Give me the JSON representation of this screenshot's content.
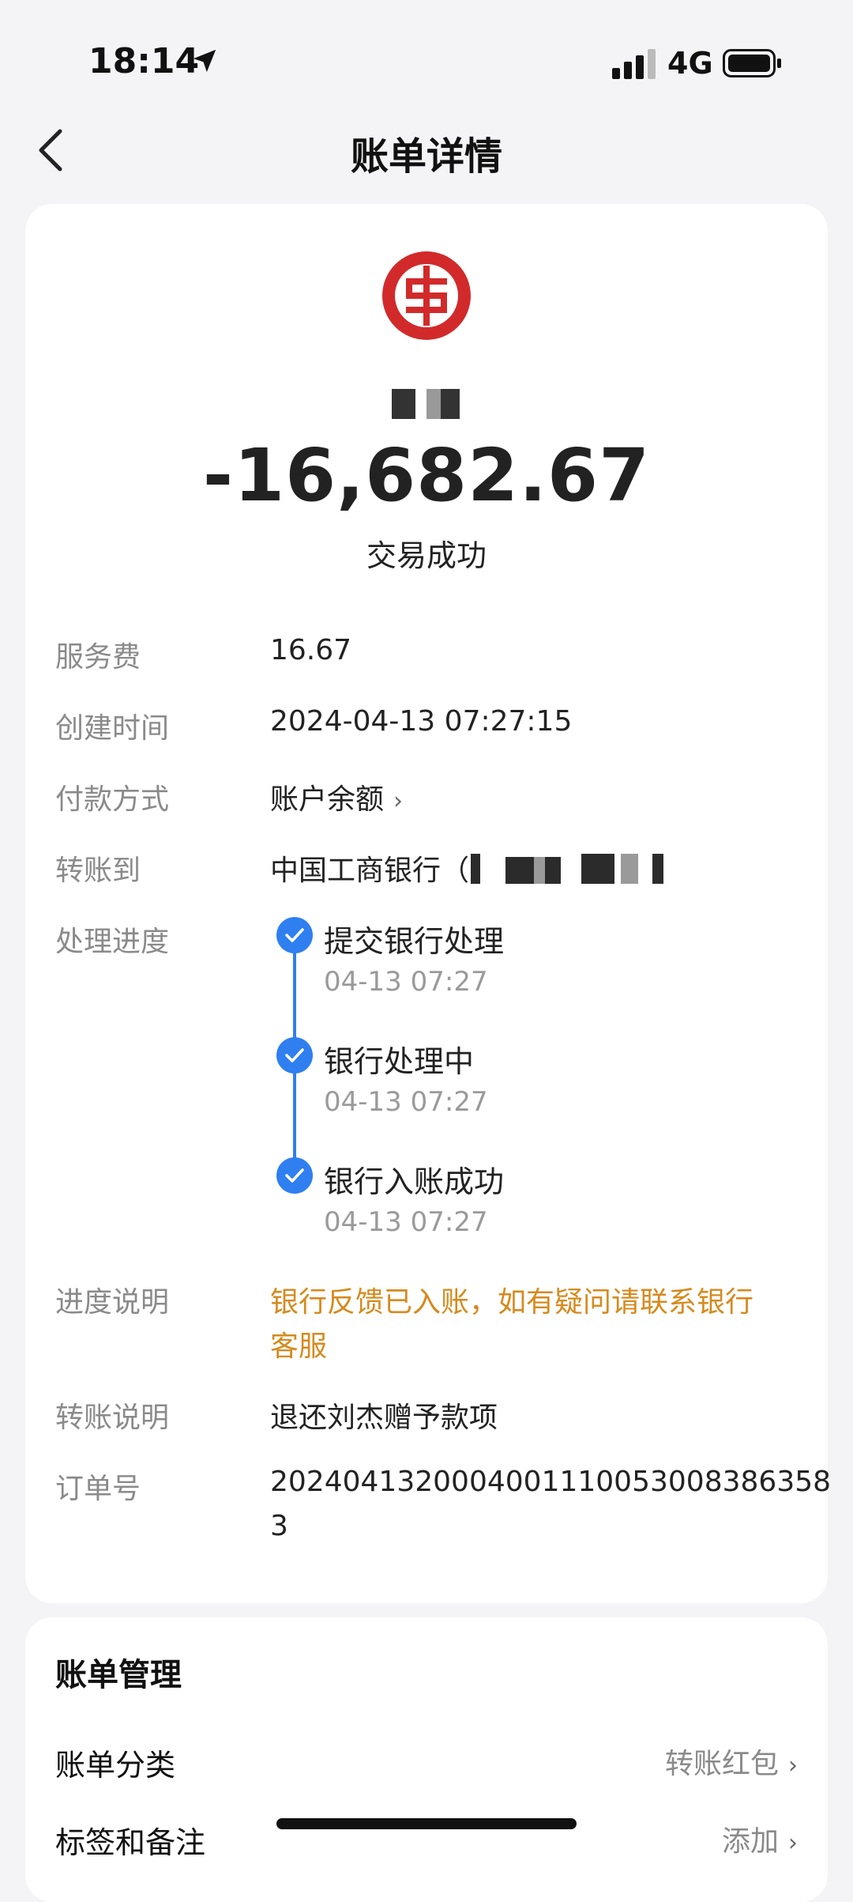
{
  "status_bar": {
    "time": "18:14",
    "network": "4G"
  },
  "nav": {
    "title": "账单详情"
  },
  "summary": {
    "amount": "-16,682.67",
    "status": "交易成功"
  },
  "details": {
    "fee_label": "服务费",
    "fee_value": "16.67",
    "created_label": "创建时间",
    "created_value": "2024-04-13 07:27:15",
    "payment_label": "付款方式",
    "payment_value": "账户余额",
    "transfer_to_label": "转账到",
    "transfer_to_value": "中国工商银行（",
    "progress_label": "处理进度",
    "steps": [
      {
        "title": "提交银行处理",
        "time": "04-13 07:27"
      },
      {
        "title": "银行处理中",
        "time": "04-13 07:27"
      },
      {
        "title": "银行入账成功",
        "time": "04-13 07:27"
      }
    ],
    "progress_note_label": "进度说明",
    "progress_note_line1": "银行反馈已入账，如有疑问请联系银行",
    "progress_note_line2": "客服",
    "memo_label": "转账说明",
    "memo_value": "退还刘杰赠予款项",
    "order_label": "订单号",
    "order_line1": "2024041320004001110053008386358",
    "order_line2": "3"
  },
  "management": {
    "title": "账单管理",
    "category_label": "账单分类",
    "category_value": "转账红包",
    "tags_label": "标签和备注",
    "tags_value": "添加"
  },
  "colors": {
    "accent": "#2f7ff0",
    "warning": "#d68a1e",
    "bank_red": "#d22a2a"
  }
}
